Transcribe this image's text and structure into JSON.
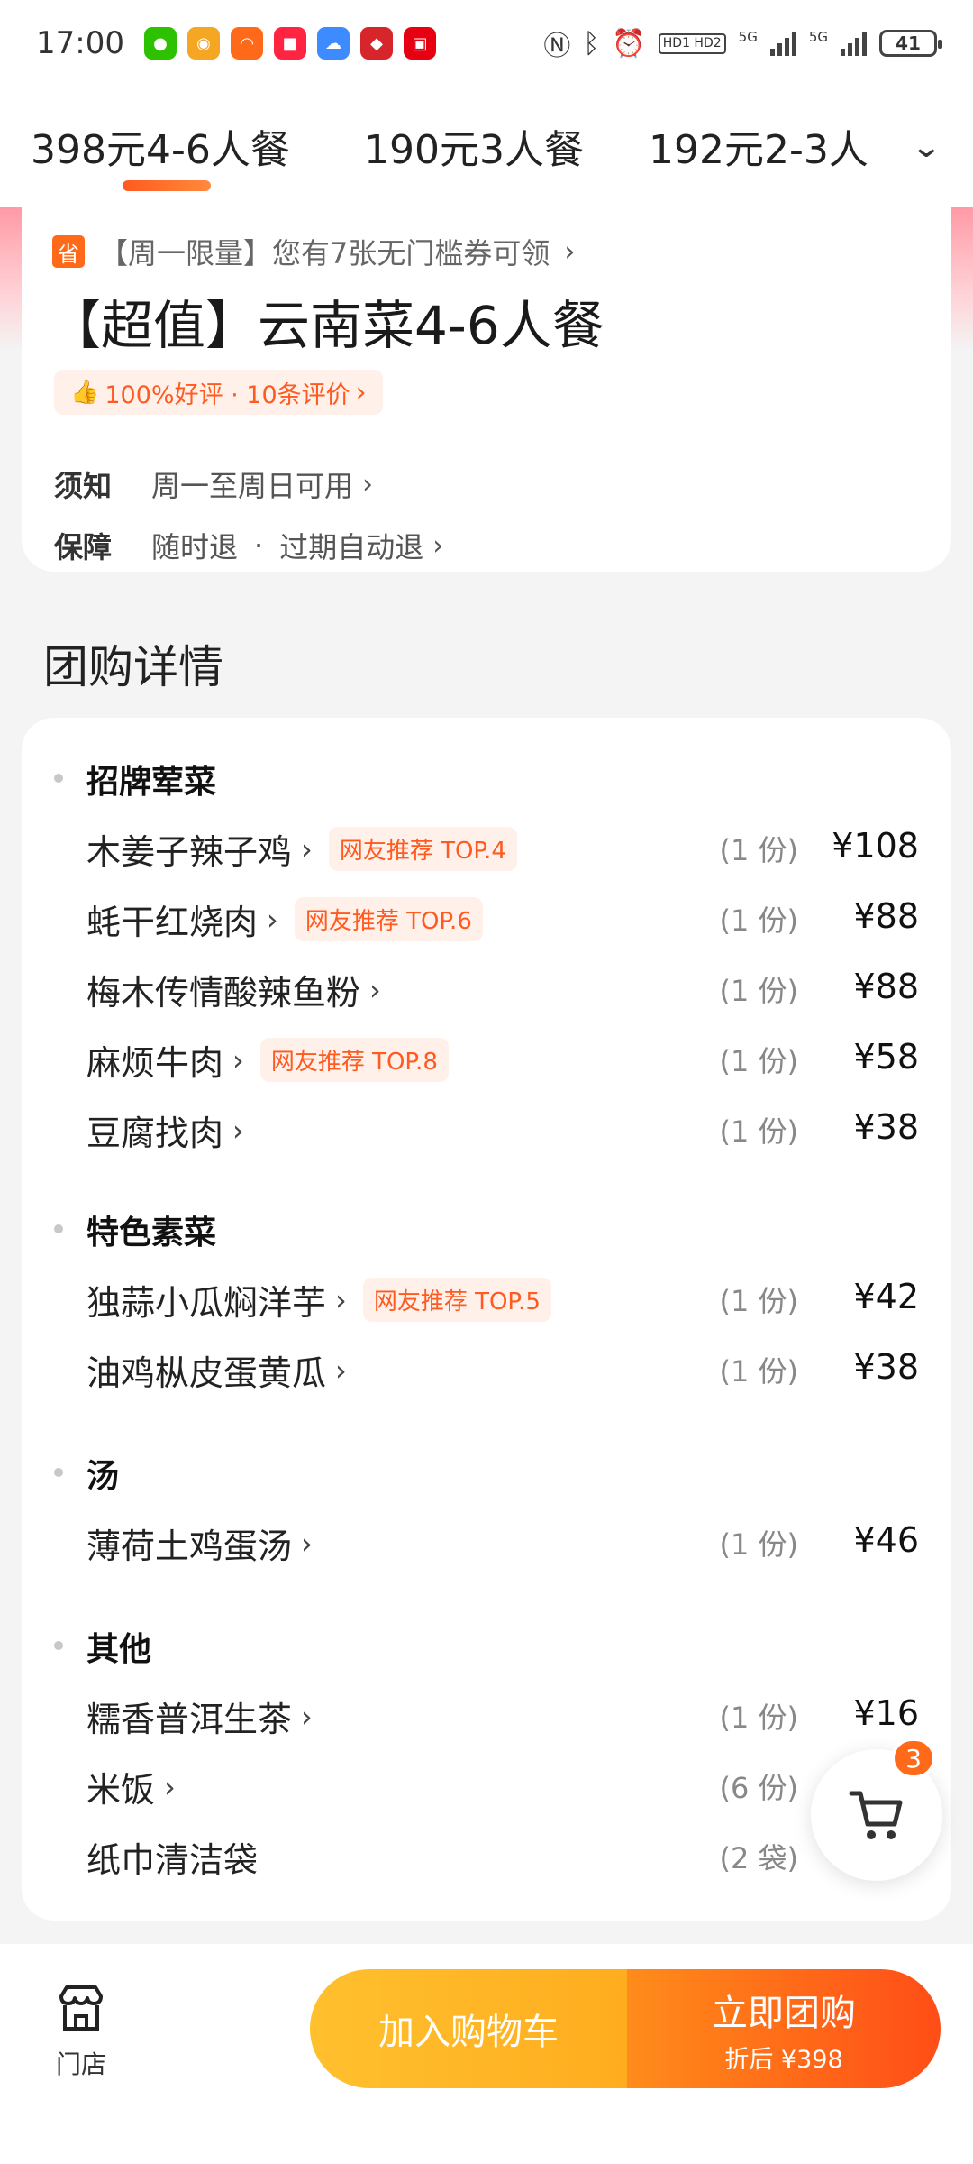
{
  "status_bar": {
    "time": "17:00",
    "battery": "41",
    "net1": "5G",
    "net2": "5G",
    "hd": "HD1 HD2"
  },
  "tabs": [
    {
      "label": "398元4-6人餐"
    },
    {
      "label": "190元3人餐"
    },
    {
      "label": "192元2-3人"
    }
  ],
  "deal": {
    "coupon_text": "【周一限量】您有7张无门槛券可领",
    "coupon_icon_text": "省",
    "title": "【超值】云南菜4-6人餐",
    "rating": "100%好评 · 10条评价",
    "notice_label": "须知",
    "notice_value": "周一至周日可用",
    "guarantee_label": "保障",
    "guarantee_value_1": "随时退",
    "guarantee_dot": "·",
    "guarantee_value_2": "过期自动退"
  },
  "detail": {
    "heading": "团购详情",
    "groups": [
      {
        "title": "招牌荤菜",
        "items": [
          {
            "name": "木姜子辣子鸡",
            "tag": "网友推荐 TOP.4",
            "qty": "(1 份)",
            "price": "¥108"
          },
          {
            "name": "蚝干红烧肉",
            "tag": "网友推荐 TOP.6",
            "qty": "(1 份)",
            "price": "¥88"
          },
          {
            "name": "梅木传情酸辣鱼粉",
            "tag": "",
            "qty": "(1 份)",
            "price": "¥88"
          },
          {
            "name": "麻烦牛肉",
            "tag": "网友推荐 TOP.8",
            "qty": "(1 份)",
            "price": "¥58"
          },
          {
            "name": "豆腐找肉",
            "tag": "",
            "qty": "(1 份)",
            "price": "¥38"
          }
        ]
      },
      {
        "title": "特色素菜",
        "items": [
          {
            "name": "独蒜小瓜焖洋芋",
            "tag": "网友推荐 TOP.5",
            "qty": "(1 份)",
            "price": "¥42"
          },
          {
            "name": "油鸡枞皮蛋黄瓜",
            "tag": "",
            "qty": "(1 份)",
            "price": "¥38"
          }
        ]
      },
      {
        "title": "汤",
        "items": [
          {
            "name": "薄荷土鸡蛋汤",
            "tag": "",
            "qty": "(1 份)",
            "price": "¥46"
          }
        ]
      },
      {
        "title": "其他",
        "items": [
          {
            "name": "糯香普洱生茶",
            "tag": "",
            "qty": "(1 份)",
            "price": "¥16"
          },
          {
            "name": "米饭",
            "tag": "",
            "qty": "(6 份)",
            "price": ""
          },
          {
            "name": "纸巾清洁袋",
            "tag": "",
            "qty": "(2 袋)",
            "price": ""
          }
        ]
      }
    ]
  },
  "cart": {
    "badge_count": "3"
  },
  "bottom": {
    "store_label": "门店",
    "add_cart_label": "加入购物车",
    "buy_label": "立即团购",
    "buy_sub": "折后 ¥398"
  },
  "colors": {
    "accent": "#ff5a1f",
    "cart_yellow": "#ffb31f",
    "buy_orange": "#ff6a1a"
  }
}
